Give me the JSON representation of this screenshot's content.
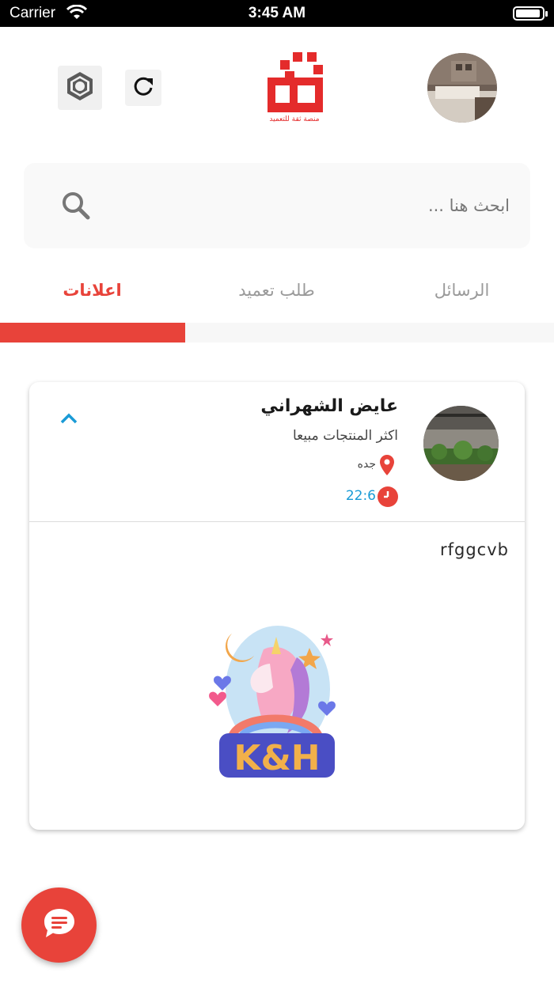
{
  "status_bar": {
    "carrier": "Carrier",
    "time": "3:45 AM"
  },
  "header": {
    "logo_text": "ثقة",
    "logo_caption": "منصة ثقة للتعميد",
    "settings_icon": "hexagon-nut-icon",
    "refresh_icon": "refresh-icon"
  },
  "search": {
    "placeholder": "ابحث هنا ...",
    "icon": "search-icon"
  },
  "tabs": [
    {
      "label": "الرسائل",
      "active": false
    },
    {
      "label": "طلب تعميد",
      "active": false
    },
    {
      "label": "اعلانات",
      "active": true
    }
  ],
  "card": {
    "name": "عايض الشهراني",
    "subtitle": "اكثر المنتجات مبيعا",
    "location": "جده",
    "time": "22:6",
    "body": "rfggcvb",
    "image_text": "K&H"
  },
  "colors": {
    "accent": "#e8433a",
    "time": "#1a9bd6",
    "chevron": "#1a9bd6"
  },
  "fab": {
    "icon": "chat-icon"
  }
}
